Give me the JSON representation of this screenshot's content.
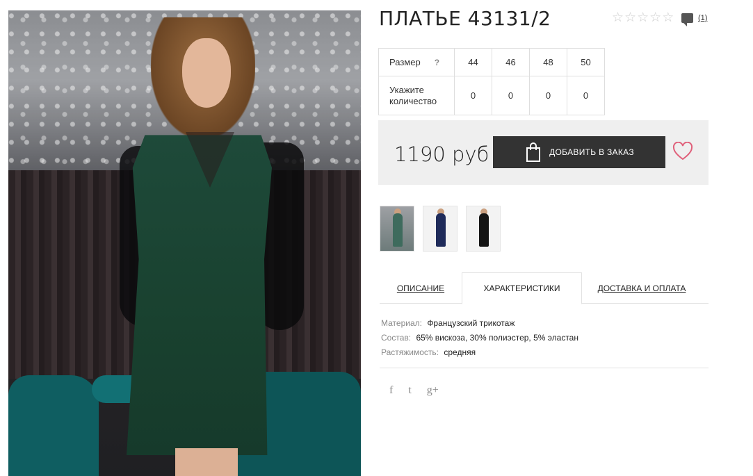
{
  "product": {
    "title": "ПЛАТЬЕ 43131/2",
    "rating_stars": 0,
    "rating_max": 5,
    "comments_count": "(1)"
  },
  "sizes": {
    "size_label": "Размер",
    "help_mark": "?",
    "qty_label": "Укажите количество",
    "columns": [
      "44",
      "46",
      "48",
      "50"
    ],
    "quantities": [
      "0",
      "0",
      "0",
      "0"
    ]
  },
  "purchase": {
    "price": "1190 руб",
    "add_button_label": "ДОБАВИТЬ В ЗАКАЗ"
  },
  "tabs": {
    "description": "ОПИСАНИЕ",
    "characteristics": "ХАРАКТЕРИСТИКИ",
    "delivery": "ДОСТАВКА И ОПЛАТА",
    "active": "characteristics"
  },
  "specs": [
    {
      "key": "Материал:",
      "value": "Французский трикотаж"
    },
    {
      "key": "Состав:",
      "value": "65% вискоза, 30% полиэстер, 5% эластан"
    },
    {
      "key": "Растяжимость:",
      "value": "средняя"
    }
  ],
  "social": {
    "facebook": "f",
    "twitter": "t",
    "googleplus": "g+"
  },
  "colors": {
    "button_bg": "#333333",
    "price_box_bg": "#efefef",
    "heart": "#e0607a",
    "star_empty": "#cfcfcf"
  },
  "icons": [
    "star-outline-icon",
    "comment-icon",
    "shopping-bag-icon",
    "heart-icon",
    "facebook-icon",
    "twitter-icon",
    "google-plus-icon"
  ]
}
